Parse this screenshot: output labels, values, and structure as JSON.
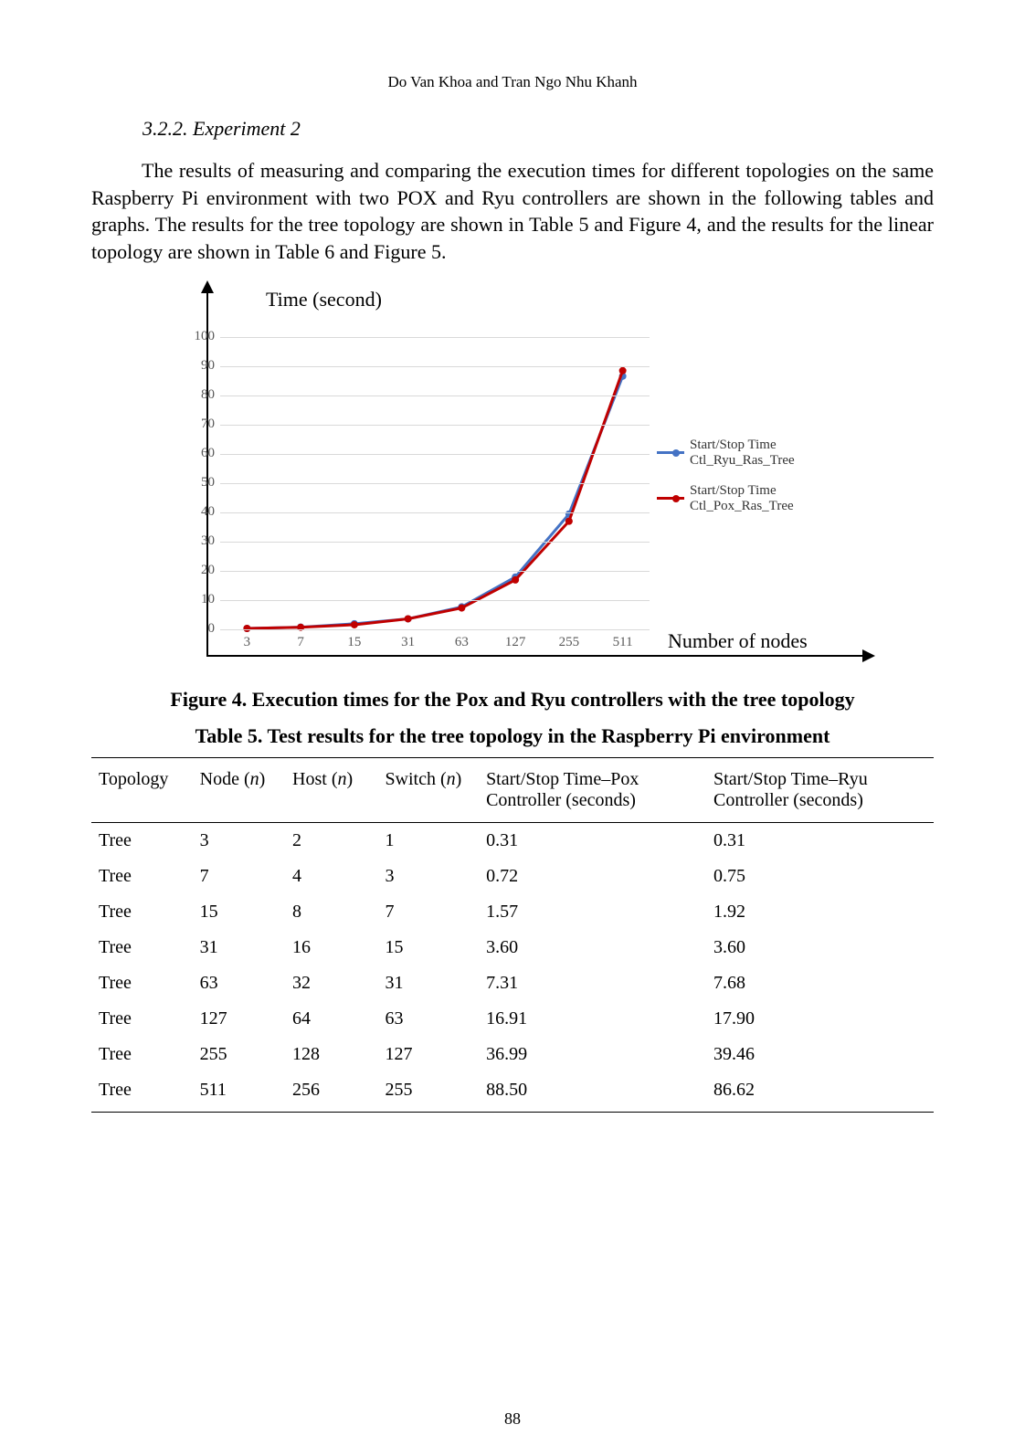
{
  "running_head": "Do Van Khoa and Tran Ngo Nhu Khanh",
  "section_heading": "3.2.2. Experiment 2",
  "body_paragraph": "The results of measuring and comparing the execution times for different topologies on the same Raspberry Pi environment with two POX and Ryu controllers are shown in the following tables and graphs. The results for the tree topology are shown in Table 5 and Figure 4, and the results for the linear topology are shown in Table 6 and Figure 5.",
  "figure_caption": "Figure 4. Execution times for the Pox and Ryu controllers with the tree topology",
  "table_caption": "Table 5. Test results for the tree topology in the Raspberry Pi environment",
  "page_number": "88",
  "chart_data": {
    "type": "line",
    "y_axis_title": "Time (second)",
    "x_axis_title": "Number of nodes",
    "categories": [
      "3",
      "7",
      "15",
      "31",
      "63",
      "127",
      "255",
      "511"
    ],
    "y_ticks": [
      "0",
      "10",
      "20",
      "30",
      "40",
      "50",
      "60",
      "70",
      "80",
      "90",
      "100"
    ],
    "ylim": [
      0,
      100
    ],
    "series": [
      {
        "name": "Start/Stop Time Ctl_Ryu_Ras_Tree",
        "color": "#4472C4",
        "values": [
          0.31,
          0.75,
          1.92,
          3.6,
          7.68,
          17.9,
          39.46,
          86.62
        ]
      },
      {
        "name": "Start/Stop Time Ctl_Pox_Ras_Tree",
        "color": "#C00000",
        "values": [
          0.31,
          0.72,
          1.57,
          3.6,
          7.31,
          16.91,
          36.99,
          88.5
        ]
      }
    ]
  },
  "table": {
    "headers": [
      "Topology",
      "Node (n)",
      "Host (n)",
      "Switch (n)",
      "Start/Stop Time–Pox Controller (seconds)",
      "Start/Stop Time–Ryu Controller (seconds)"
    ],
    "header_html": [
      "Topology",
      "Node (<i>n</i>)",
      "Host (<i>n</i>)",
      "Switch (<i>n</i>)",
      "Start/Stop Time–Pox Controller (seconds)",
      "Start/Stop Time–Ryu Controller (seconds)"
    ],
    "rows": [
      [
        "Tree",
        "3",
        "2",
        "1",
        "0.31",
        "0.31"
      ],
      [
        "Tree",
        "7",
        "4",
        "3",
        "0.72",
        "0.75"
      ],
      [
        "Tree",
        "15",
        "8",
        "7",
        "1.57",
        "1.92"
      ],
      [
        "Tree",
        "31",
        "16",
        "15",
        "3.60",
        "3.60"
      ],
      [
        "Tree",
        "63",
        "32",
        "31",
        "7.31",
        "7.68"
      ],
      [
        "Tree",
        "127",
        "64",
        "63",
        "16.91",
        "17.90"
      ],
      [
        "Tree",
        "255",
        "128",
        "127",
        "36.99",
        "39.46"
      ],
      [
        "Tree",
        "511",
        "256",
        "255",
        "88.50",
        "86.62"
      ]
    ]
  }
}
